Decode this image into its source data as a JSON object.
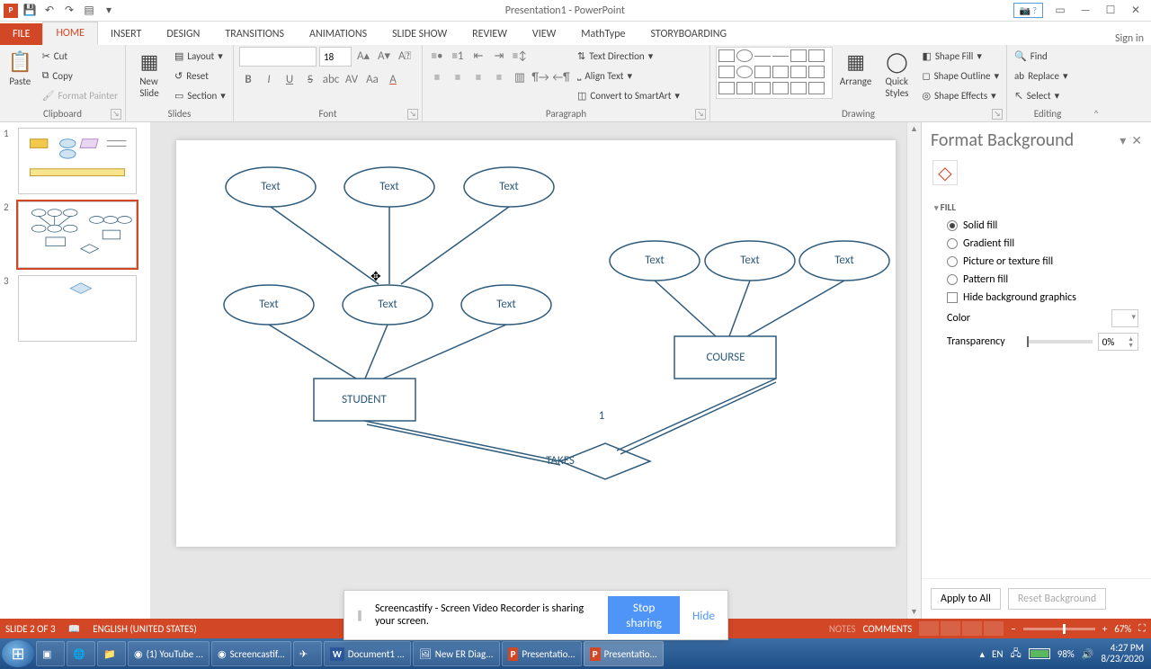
{
  "app": {
    "title": "Presentation1 - PowerPoint",
    "help_label": "?",
    "sign_in": "Sign in"
  },
  "tabs": {
    "file": "FILE",
    "home": "HOME",
    "insert": "INSERT",
    "design": "DESIGN",
    "transitions": "TRANSITIONS",
    "animations": "ANIMATIONS",
    "slideshow": "SLIDE SHOW",
    "review": "REVIEW",
    "view": "VIEW",
    "mathtype": "MathType",
    "storyboarding": "STORYBOARDING"
  },
  "ribbon": {
    "paste": "Paste",
    "cut": "Cut",
    "copy": "Copy",
    "format_painter": "Format Painter",
    "clipboard": "Clipboard",
    "new_slide": "New\nSlide",
    "layout": "Layout",
    "reset": "Reset",
    "section": "Section",
    "slides": "Slides",
    "font_size": "18",
    "font": "Font",
    "paragraph": "Paragraph",
    "text_direction": "Text Direction",
    "align_text": "Align Text",
    "convert_smartart": "Convert to SmartArt",
    "arrange": "Arrange",
    "quick_styles": "Quick\nStyles",
    "shape_fill": "Shape Fill",
    "shape_outline": "Shape Outline",
    "shape_effects": "Shape Effects",
    "drawing": "Drawing",
    "find": "Find",
    "replace": "Replace",
    "select": "Select",
    "editing": "Editing"
  },
  "slide": {
    "attr": "Text",
    "student": "STUDENT",
    "course": "COURSE",
    "takes": "TAKES",
    "card": "1"
  },
  "pane": {
    "title": "Format Background",
    "section_fill": "FILL",
    "solid_fill": "Solid fill",
    "gradient_fill": "Gradient fill",
    "picture_fill": "Picture or texture fill",
    "pattern_fill": "Pattern fill",
    "hide_bg": "Hide background graphics",
    "color": "Color",
    "transparency": "Transparency",
    "transparency_val": "0%",
    "apply_all": "Apply to All",
    "reset_bg": "Reset Background"
  },
  "share": {
    "msg": "Screencastify - Screen Video Recorder is sharing your screen.",
    "stop": "Stop sharing",
    "hide": "Hide"
  },
  "status": {
    "slide": "SLIDE 2 OF 3",
    "lang": "ENGLISH (UNITED STATES)",
    "comments": "COMMENTS",
    "notes": "NOTES",
    "zoom": "67%"
  },
  "taskbar": {
    "items": [
      "(1) YouTube ...",
      "Screencastif...",
      "",
      "Document1 ...",
      "New ER Diag...",
      "Presentatio...",
      "Presentatio..."
    ],
    "lang": "EN",
    "battery": "98%",
    "time": "4:27 PM",
    "date": "8/23/2020"
  },
  "thumbs": {
    "n1": "1",
    "n2": "2",
    "n3": "3"
  }
}
